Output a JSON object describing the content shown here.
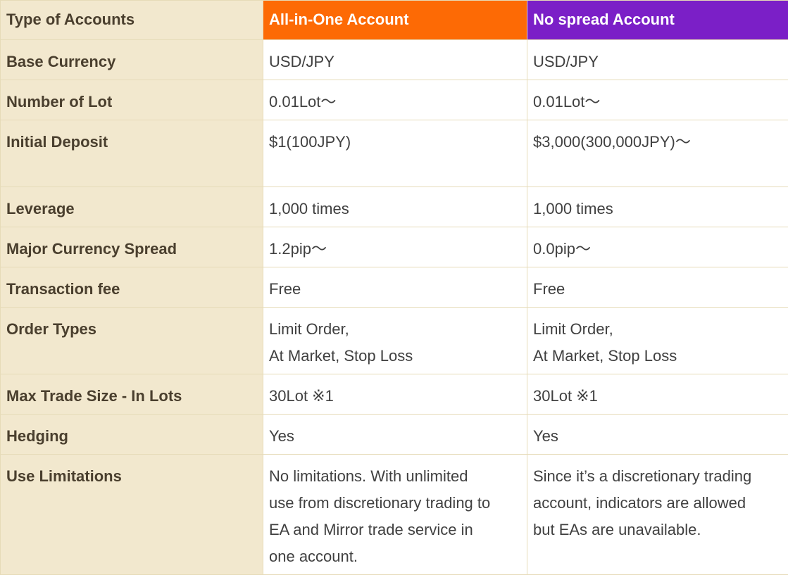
{
  "header": {
    "label": "Type of Accounts",
    "account_1": "All-in-One Account",
    "account_2": "No spread Account",
    "account_1_color": "#fd6a05",
    "account_2_color": "#7b1fc7"
  },
  "rows": [
    {
      "label": "Base Currency",
      "account_1": [
        "USD/JPY"
      ],
      "account_2": [
        "USD/JPY"
      ]
    },
    {
      "label": "Number of Lot",
      "account_1": [
        "0.01Lot〜"
      ],
      "account_2": [
        "0.01Lot〜"
      ]
    },
    {
      "label": "Initial Deposit",
      "account_1": [
        "$1(100JPY)"
      ],
      "account_2": [
        "$3,000(300,000JPY)〜"
      ]
    },
    {
      "label": "Leverage",
      "account_1": [
        "1,000 times"
      ],
      "account_2": [
        "1,000 times"
      ]
    },
    {
      "label": "Major Currency Spread",
      "account_1": [
        "1.2pip〜"
      ],
      "account_2": [
        "0.0pip〜"
      ]
    },
    {
      "label": "Transaction fee",
      "account_1": [
        "Free"
      ],
      "account_2": [
        "Free"
      ]
    },
    {
      "label": "Order Types",
      "account_1": [
        "Limit Order,",
        "At Market, Stop Loss"
      ],
      "account_2": [
        "Limit Order,",
        "At Market, Stop Loss"
      ]
    },
    {
      "label": "Max Trade Size - In Lots",
      "account_1": [
        "30Lot ※1"
      ],
      "account_2": [
        "30Lot ※1"
      ]
    },
    {
      "label": "Hedging",
      "account_1": [
        "Yes"
      ],
      "account_2": [
        "Yes"
      ]
    },
    {
      "label": "Use Limitations",
      "account_1": [
        "No limitations. With unlimited",
        "use from discretionary trading to",
        "EA and Mirror trade service in",
        "one account."
      ],
      "account_2": [
        "Since it’s a discretionary trading",
        "account, indicators are allowed",
        "but EAs are unavailable."
      ]
    }
  ]
}
